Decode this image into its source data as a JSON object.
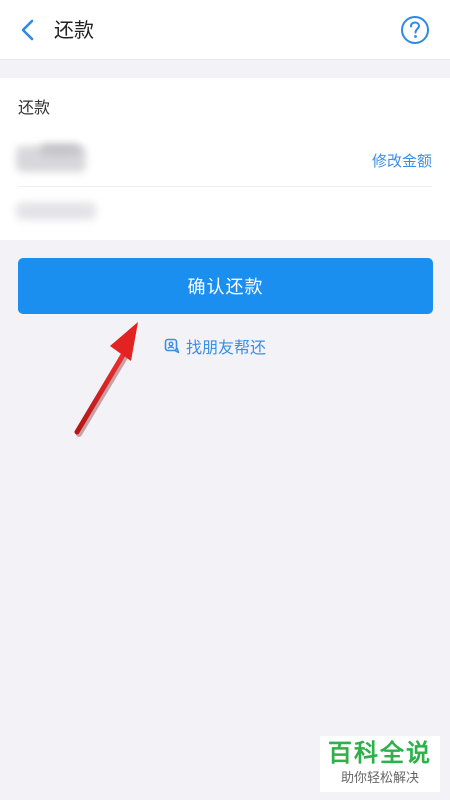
{
  "nav": {
    "title": "还款",
    "back_icon": "chevron-left-icon",
    "help_icon": "question-circle-icon"
  },
  "card": {
    "label": "还款",
    "modify_label": "修改金额"
  },
  "confirm": {
    "label": "确认还款"
  },
  "friend": {
    "label": "找朋友帮还",
    "icon": "friend-help-icon"
  },
  "watermark": {
    "title": "百科全说",
    "subtitle": "助你轻松解决"
  },
  "colors": {
    "accent": "#1b8ff0",
    "link": "#3a8ee6",
    "background": "#f2f2f7",
    "annotation": "#e32222",
    "watermark_green": "#2fb04a"
  }
}
